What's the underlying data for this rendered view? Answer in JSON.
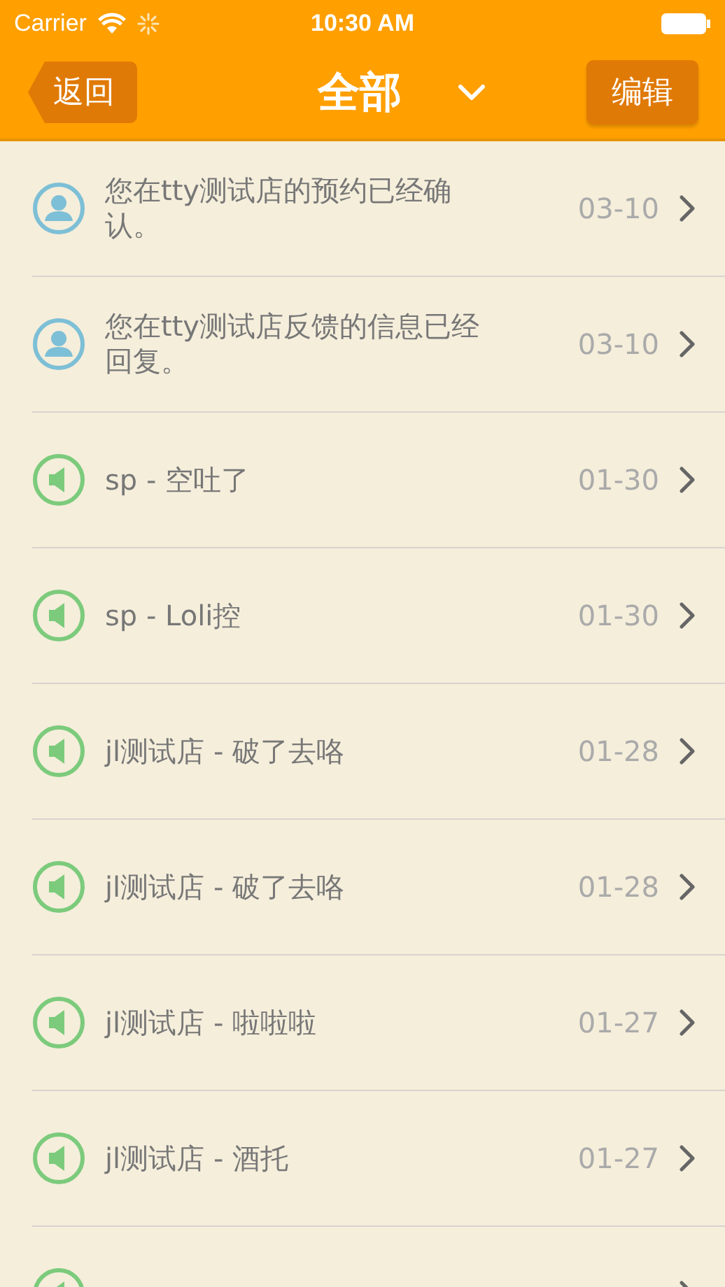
{
  "status_bar": {
    "carrier": "Carrier",
    "time": "10:30 AM"
  },
  "nav_bar": {
    "back_button": "返回",
    "title": "全部",
    "edit_button": "编辑"
  },
  "messages": [
    {
      "kind": "user",
      "text": "您在tty测试店的预约已经确认。",
      "date": "03-10"
    },
    {
      "kind": "user",
      "text": "您在tty测试店反馈的信息已经回复。",
      "date": "03-10"
    },
    {
      "kind": "notice",
      "text": "sp - 空吐了",
      "date": "01-30"
    },
    {
      "kind": "notice",
      "text": "sp - Loli控",
      "date": "01-30"
    },
    {
      "kind": "notice",
      "text": "jl测试店 - 破了去咯",
      "date": "01-28"
    },
    {
      "kind": "notice",
      "text": "jl测试店 - 破了去咯",
      "date": "01-28"
    },
    {
      "kind": "notice",
      "text": "jl测试店 - 啦啦啦",
      "date": "01-27"
    },
    {
      "kind": "notice",
      "text": "jl测试店 - 酒托",
      "date": "01-27"
    },
    {
      "kind": "notice"
    }
  ]
}
